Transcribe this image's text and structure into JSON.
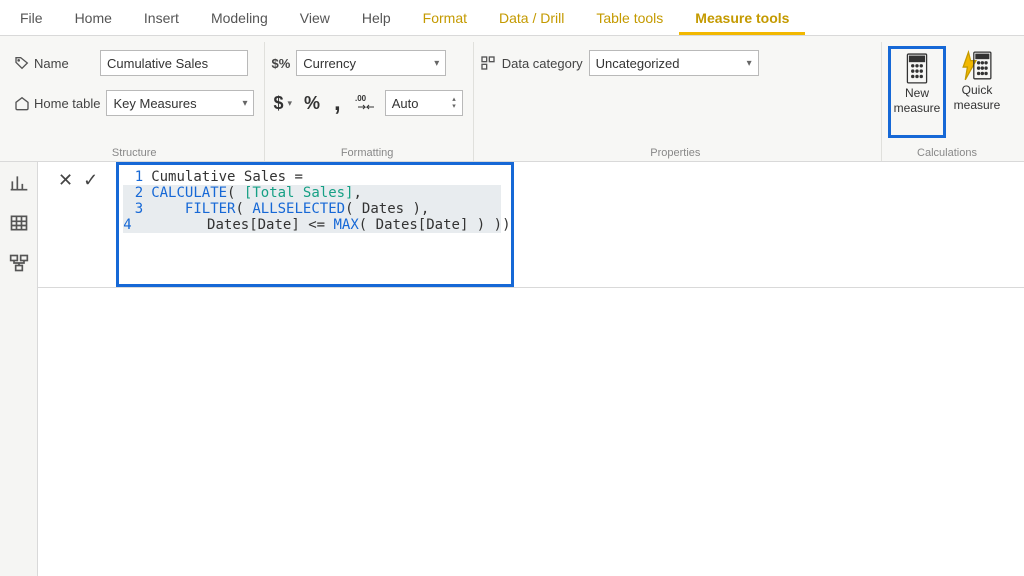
{
  "menubar": {
    "items": [
      {
        "label": "File",
        "kind": "file"
      },
      {
        "label": "Home"
      },
      {
        "label": "Insert"
      },
      {
        "label": "Modeling"
      },
      {
        "label": "View"
      },
      {
        "label": "Help"
      },
      {
        "label": "Format",
        "kind": "accent"
      },
      {
        "label": "Data / Drill",
        "kind": "accent"
      },
      {
        "label": "Table tools",
        "kind": "accent"
      },
      {
        "label": "Measure tools",
        "kind": "active"
      }
    ]
  },
  "ribbon": {
    "structure": {
      "group_label": "Structure",
      "name_label": "Name",
      "name_value": "Cumulative Sales",
      "home_table_label": "Home table",
      "home_table_value": "Key Measures"
    },
    "formatting": {
      "group_label": "Formatting",
      "format_prefix": "$%",
      "format_value": "Currency",
      "decimals_value": "Auto",
      "btn_currency": "$",
      "btn_percent": "%",
      "btn_thousands": ",",
      "btn_dec": ".00"
    },
    "properties": {
      "group_label": "Properties",
      "data_category_label": "Data category",
      "data_category_value": "Uncategorized"
    },
    "calculations": {
      "group_label": "Calculations",
      "new_measure_line1": "New",
      "new_measure_line2": "measure",
      "quick_measure_line1": "Quick",
      "quick_measure_line2": "measure"
    }
  },
  "formula": {
    "lines": [
      {
        "n": "1",
        "tokens": [
          {
            "t": "Cumulative Sales = ",
            "c": "txt"
          }
        ]
      },
      {
        "n": "2",
        "tokens": [
          {
            "t": "CALCULATE",
            "c": "fn"
          },
          {
            "t": "( ",
            "c": "txt"
          },
          {
            "t": "[Total Sales]",
            "c": "col"
          },
          {
            "t": ",",
            "c": "txt"
          }
        ]
      },
      {
        "n": "3",
        "tokens": [
          {
            "t": "    ",
            "c": "txt"
          },
          {
            "t": "FILTER",
            "c": "fn"
          },
          {
            "t": "( ",
            "c": "txt"
          },
          {
            "t": "ALLSELECTED",
            "c": "fn"
          },
          {
            "t": "( Dates ),",
            "c": "txt"
          }
        ]
      },
      {
        "n": "4",
        "tokens": [
          {
            "t": "        Dates[Date] <= ",
            "c": "txt"
          },
          {
            "t": "MAX",
            "c": "fn"
          },
          {
            "t": "( Dates[Date] ) ))",
            "c": "txt"
          }
        ]
      }
    ]
  }
}
